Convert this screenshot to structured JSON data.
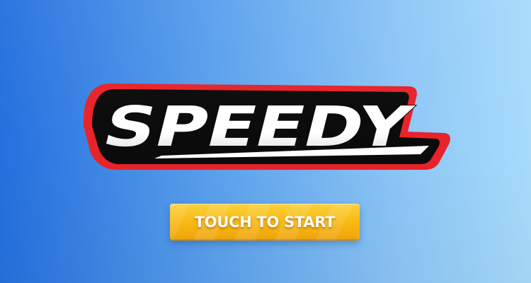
{
  "title": {
    "logo_text": "SPEEDY"
  },
  "start_button": {
    "label": "TOUCH TO START"
  },
  "colors": {
    "background_left": "#2470de",
    "background_right": "#a7dcfb",
    "logo_outline": "#e8232a",
    "logo_shadow": "#0a0a0a",
    "logo_fill": "#ffffff",
    "button_top": "#ffd43a",
    "button_bottom": "#f4a60a"
  }
}
